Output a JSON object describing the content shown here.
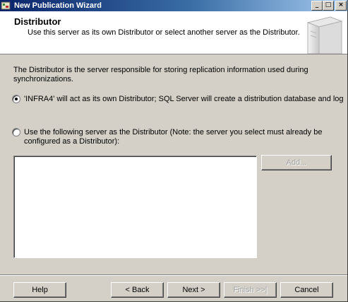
{
  "window": {
    "title": "New Publication Wizard",
    "controls": {
      "minimize": "_",
      "maximize": "□",
      "close": "×"
    }
  },
  "header": {
    "title": "Distributor",
    "subtitle": "Use this server as its own Distributor or select another server as the Distributor.",
    "graphic_icon": "server-tower-icon"
  },
  "body": {
    "description": "The Distributor is the server responsible for storing replication information used during synchronizations.",
    "options": [
      {
        "label": "'INFRA4' will act as its own Distributor; SQL Server will create a distribution database and log",
        "selected": true
      },
      {
        "label": "Use the following server as the Distributor (Note: the server you select must already be configured as a Distributor):",
        "selected": false
      }
    ],
    "server_list": [],
    "add_button": "Add..."
  },
  "footer": {
    "help": "Help",
    "back": "< Back",
    "next": "Next >",
    "finish": "Finish >>|",
    "cancel": "Cancel"
  },
  "colors": {
    "titlebar_start": "#0a246a",
    "titlebar_end": "#a6caf0",
    "dialog_bg": "#d4d0c8"
  }
}
